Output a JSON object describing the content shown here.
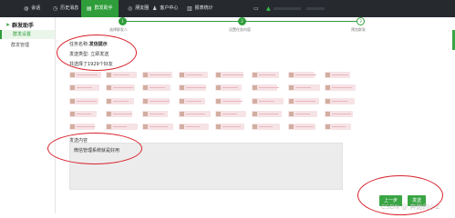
{
  "topbar": {
    "items": [
      {
        "label": "会话",
        "icon": "chat-icon"
      },
      {
        "label": "历史消息",
        "icon": "history-icon"
      },
      {
        "label": "群发助手",
        "icon": "broadcast-icon",
        "active": true
      },
      {
        "label": "朋友圈",
        "icon": "moments-icon"
      },
      {
        "label": "客户中心",
        "icon": "customer-icon"
      },
      {
        "label": "报表统计",
        "icon": "report-icon"
      }
    ]
  },
  "sidebar": {
    "title": "群发助手",
    "items": [
      {
        "label": "群发设置",
        "active": true
      },
      {
        "label": "群发管理",
        "active": false
      }
    ]
  },
  "steps": [
    {
      "num": "1",
      "label": "选择群发人"
    },
    {
      "num": "2",
      "label": "设置任务内容"
    },
    {
      "num": "3",
      "label": "预览群发"
    }
  ],
  "task": {
    "name_label": "任务名称:",
    "name_value": "发信提示",
    "type_label": "发送类型:",
    "type_value": "立即发送",
    "selected_text": "共选择了1929个好友"
  },
  "content": {
    "label": "发送内容",
    "value": "微信管理系统就是好用"
  },
  "buttons": {
    "prev": "上一步",
    "next": "发送"
  },
  "watermark": "CSDN @ 奔跑的小Z",
  "colors": {
    "accent": "#2e9d3a",
    "topbar": "#262a2f",
    "annotation": "#d8202a"
  }
}
